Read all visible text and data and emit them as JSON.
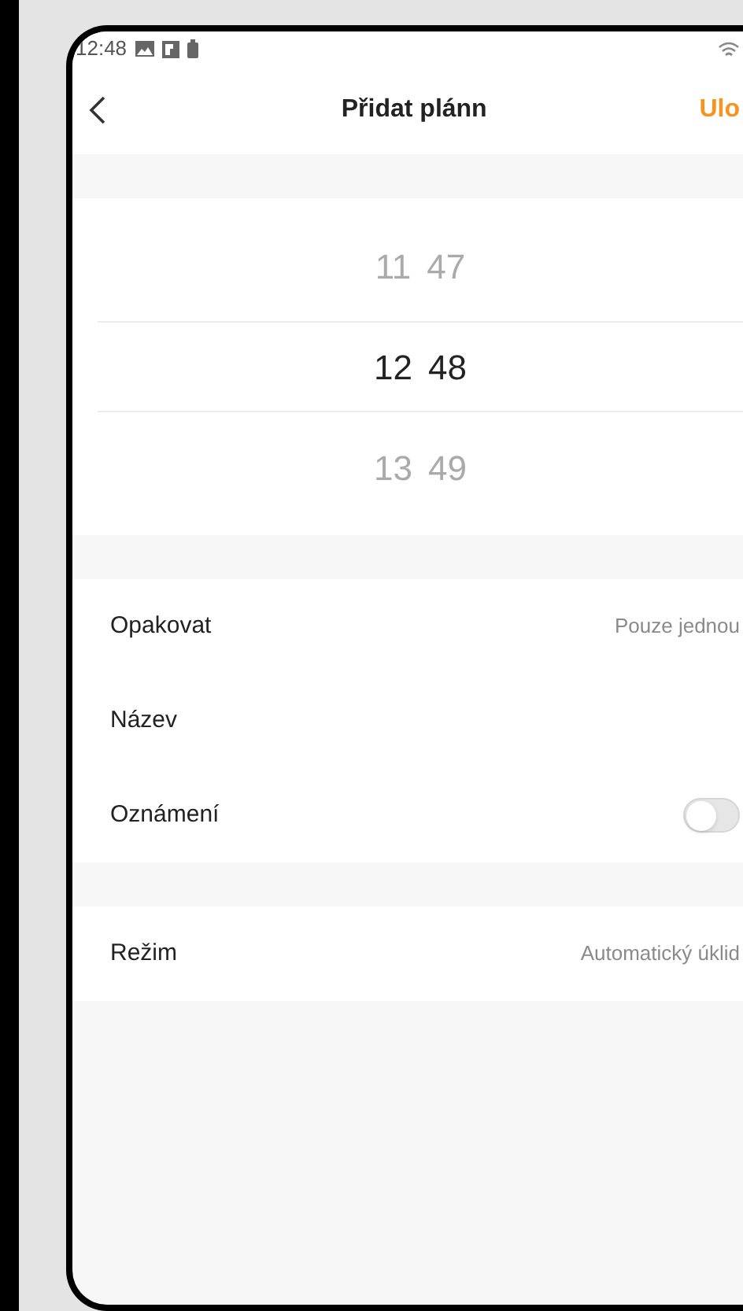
{
  "status_bar": {
    "time": "12:48"
  },
  "header": {
    "title": "Přidat plánn",
    "save": "Ulo"
  },
  "time_picker": {
    "rows": [
      {
        "hour": "11",
        "minute": "47",
        "selected": false
      },
      {
        "hour": "12",
        "minute": "48",
        "selected": true
      },
      {
        "hour": "13",
        "minute": "49",
        "selected": false
      }
    ]
  },
  "settings": [
    [
      {
        "kind": "value",
        "label": "Opakovat",
        "value": "Pouze jednou"
      },
      {
        "kind": "plain",
        "label": "Název"
      },
      {
        "kind": "toggle",
        "label": "Oznámení",
        "on": false
      }
    ],
    [
      {
        "kind": "value",
        "label": "Režim",
        "value": "Automatický úklid"
      }
    ]
  ]
}
